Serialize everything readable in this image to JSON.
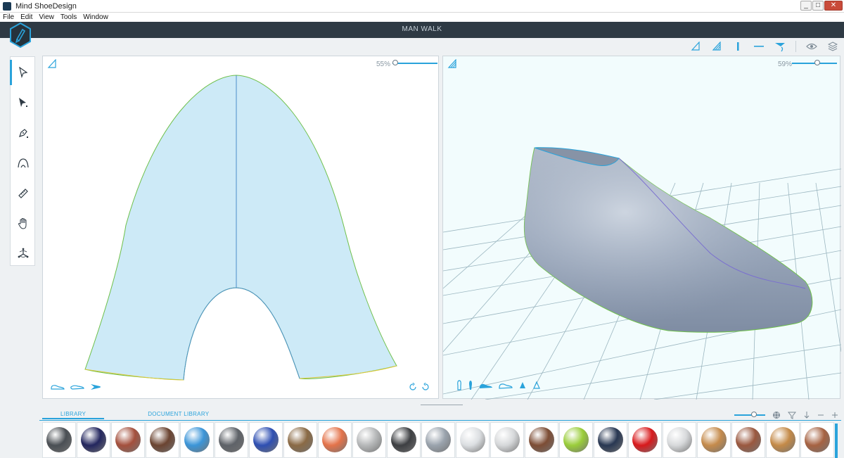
{
  "window": {
    "title": "Mind ShoeDesign",
    "controls": [
      "_",
      "□",
      "✕"
    ]
  },
  "menu": [
    "File",
    "Edit",
    "View",
    "Tools",
    "Window"
  ],
  "header": {
    "document_title": "MAN WALK"
  },
  "viewports": {
    "left": {
      "zoom_label": "55%",
      "zoom_level": 0.55
    },
    "right": {
      "zoom_label": "59%",
      "zoom_level": 0.59
    }
  },
  "left_tools": [
    {
      "icon": "select-arrow-icon",
      "active": true
    },
    {
      "icon": "direct-select-icon",
      "active": false
    },
    {
      "icon": "pen-tool-icon",
      "active": false
    },
    {
      "icon": "curve-tool-icon",
      "active": false
    },
    {
      "icon": "ruler-icon",
      "active": false
    },
    {
      "icon": "hand-pan-icon",
      "active": false
    },
    {
      "icon": "gizmo-move-icon",
      "active": false
    }
  ],
  "top_tools": [
    "triangle-outline-icon",
    "triangle-fill-icon",
    "vertical-line-icon",
    "horizontal-line-icon",
    "funnel-curve-icon",
    "eye-icon",
    "layers-icon"
  ],
  "library": {
    "tabs": [
      "LIBRARY",
      "DOCUMENT LIBRARY"
    ],
    "active_tab": 0,
    "tool_icons": [
      "size-slider-icon",
      "texture-icon",
      "filter-icon",
      "download-icon",
      "minus-icon",
      "plus-icon"
    ],
    "materials": [
      {
        "color": "#4a4f54"
      },
      {
        "color": "#23265e"
      },
      {
        "color": "#a4503d"
      },
      {
        "color": "#6b4431"
      },
      {
        "color": "#3b95d8"
      },
      {
        "color": "#5e6268"
      },
      {
        "color": "#2e4fb2"
      },
      {
        "color": "#8a6a45"
      },
      {
        "color": "#e4734a"
      },
      {
        "color": "#b6b8b9"
      },
      {
        "color": "#3d3f42"
      },
      {
        "color": "#9aa3ad"
      },
      {
        "color": "#dcdfe2"
      },
      {
        "color": "#d6d8da"
      },
      {
        "color": "#7d4d35"
      },
      {
        "color": "#9acd3a"
      },
      {
        "color": "#283752"
      },
      {
        "color": "#d8191c"
      },
      {
        "color": "#d7d9db"
      },
      {
        "color": "#c58b4c"
      },
      {
        "color": "#9a583f"
      },
      {
        "color": "#c48a48"
      },
      {
        "color": "#a66242"
      }
    ]
  }
}
